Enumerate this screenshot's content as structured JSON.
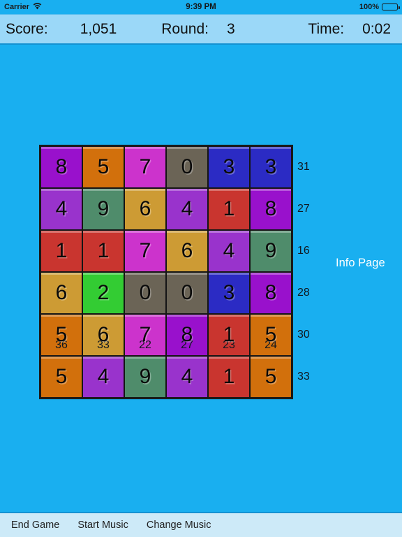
{
  "status_bar": {
    "carrier": "Carrier",
    "wifi_icon": "wifi-icon",
    "time": "9:39 PM",
    "battery_percent": "100%"
  },
  "score_bar": {
    "score_label": "Score:",
    "score_value": "1,051",
    "round_label": "Round:",
    "round_value": "3",
    "time_label": "Time:",
    "time_value": "0:02"
  },
  "info_link": {
    "label": "Info Page"
  },
  "toolbar": {
    "end_game_label": "End Game",
    "start_music_label": "Start Music",
    "change_music_label": "Change Music"
  },
  "colors": {
    "background": "#19AFF0",
    "score_bar_bg": "#9BD8F8",
    "toolbar_bg": "#CDEAF8",
    "purple": "#9911CC",
    "medium_purple": "#9933CC",
    "magenta": "#CC33CC",
    "orange": "#D2700C",
    "goldenrod": "#CD9B34",
    "red": "#C9352F",
    "blue": "#2B2BC4",
    "sea_green": "#4F8C6B",
    "green": "#33CC33",
    "taupe": "#6B6456"
  },
  "grid": {
    "rows": 6,
    "cols": 6,
    "cells": [
      [
        {
          "value": "8",
          "color": "#9911CC"
        },
        {
          "value": "5",
          "color": "#D2700C"
        },
        {
          "value": "7",
          "color": "#CC33CC"
        },
        {
          "value": "0",
          "color": "#6B6456"
        },
        {
          "value": "3",
          "color": "#2B2BC4"
        },
        {
          "value": "3",
          "color": "#2B2BC4"
        }
      ],
      [
        {
          "value": "4",
          "color": "#9933CC"
        },
        {
          "value": "9",
          "color": "#4F8C6B"
        },
        {
          "value": "6",
          "color": "#CD9B34"
        },
        {
          "value": "4",
          "color": "#9933CC"
        },
        {
          "value": "1",
          "color": "#C9352F"
        },
        {
          "value": "8",
          "color": "#9911CC"
        }
      ],
      [
        {
          "value": "1",
          "color": "#C9352F"
        },
        {
          "value": "1",
          "color": "#C9352F"
        },
        {
          "value": "7",
          "color": "#CC33CC"
        },
        {
          "value": "6",
          "color": "#CD9B34"
        },
        {
          "value": "4",
          "color": "#9933CC"
        },
        {
          "value": "9",
          "color": "#4F8C6B"
        }
      ],
      [
        {
          "value": "6",
          "color": "#CD9B34"
        },
        {
          "value": "2",
          "color": "#33CC33"
        },
        {
          "value": "0",
          "color": "#6B6456"
        },
        {
          "value": "0",
          "color": "#6B6456"
        },
        {
          "value": "3",
          "color": "#2B2BC4"
        },
        {
          "value": "8",
          "color": "#9911CC"
        }
      ],
      [
        {
          "value": "5",
          "color": "#D2700C"
        },
        {
          "value": "6",
          "color": "#CD9B34"
        },
        {
          "value": "7",
          "color": "#CC33CC"
        },
        {
          "value": "8",
          "color": "#9911CC"
        },
        {
          "value": "1",
          "color": "#C9352F"
        },
        {
          "value": "5",
          "color": "#D2700C"
        }
      ],
      [
        {
          "value": "5",
          "color": "#D2700C"
        },
        {
          "value": "4",
          "color": "#9933CC"
        },
        {
          "value": "9",
          "color": "#4F8C6B"
        },
        {
          "value": "4",
          "color": "#9933CC"
        },
        {
          "value": "1",
          "color": "#C9352F"
        },
        {
          "value": "5",
          "color": "#D2700C"
        }
      ]
    ],
    "row_sums": [
      "31",
      "27",
      "16",
      "28",
      "30",
      "33"
    ],
    "col_sums": [
      "36",
      "33",
      "22",
      "27",
      "23",
      "24"
    ]
  }
}
